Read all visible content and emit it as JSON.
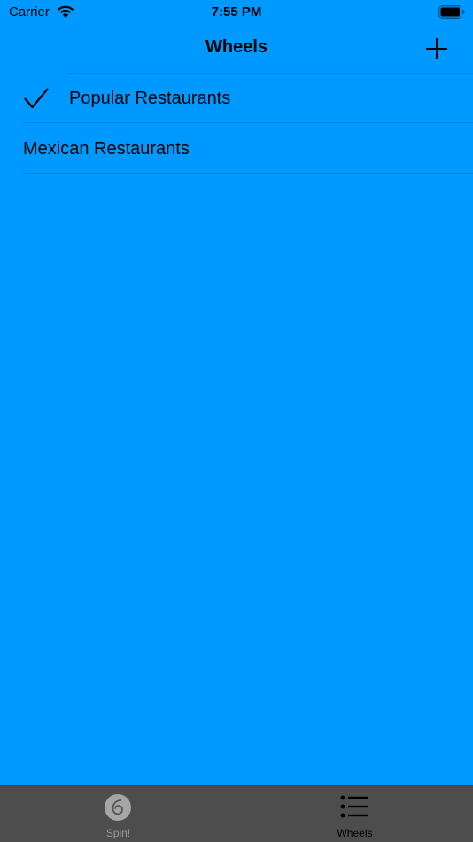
{
  "status_bar": {
    "carrier": "Carrier",
    "time": "7:55 PM"
  },
  "nav": {
    "title": "Wheels",
    "add_icon": "plus-icon"
  },
  "list": {
    "items": [
      {
        "label": "Popular Restaurants",
        "checked": true
      },
      {
        "label": "Mexican Restaurants",
        "checked": false
      }
    ]
  },
  "tabs": [
    {
      "label": "Spin!",
      "icon": "spin-icon",
      "selected": false
    },
    {
      "label": "Wheels",
      "icon": "list-icon",
      "selected": true
    }
  ],
  "colors": {
    "background": "#0099FF",
    "tab_bar": "#4D4D4D",
    "tab_selected": "#000000",
    "tab_unselected": "#9A9A9A"
  }
}
